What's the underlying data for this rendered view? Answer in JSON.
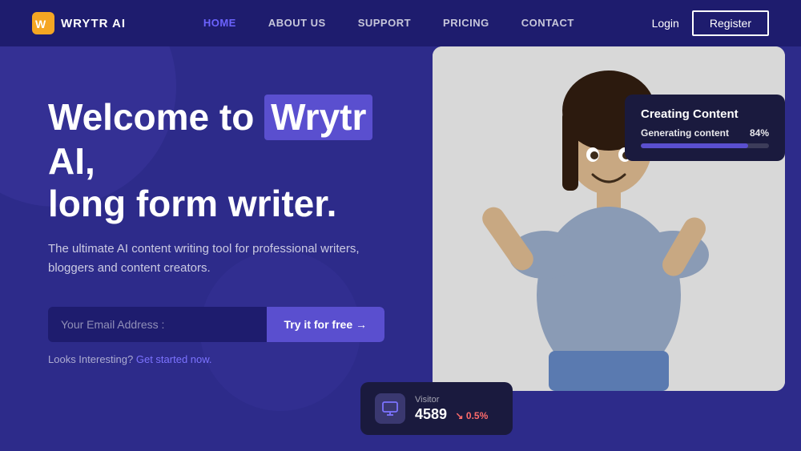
{
  "navbar": {
    "logo_text": "WRYTR AI",
    "links": [
      {
        "label": "HOME",
        "active": true
      },
      {
        "label": "ABOUT US",
        "active": false
      },
      {
        "label": "SUPPORT",
        "active": false
      },
      {
        "label": "PRICING",
        "active": false
      },
      {
        "label": "CONTACT",
        "active": false
      }
    ],
    "login_label": "Login",
    "register_label": "Register"
  },
  "hero": {
    "title_prefix": "Welcome to",
    "title_highlight": "Wrytr",
    "title_suffix": "AI,",
    "title_line2": "long form writer.",
    "subtitle": "The ultimate AI content writing tool for professional writers, bloggers and content creators.",
    "email_placeholder": "Your Email Address :",
    "cta_button": "Try it for free →",
    "note_prefix": "Looks Interesting?",
    "note_link": "Get started now."
  },
  "creating_content": {
    "title": "Creating Content",
    "label": "Generating content",
    "percent": "84%",
    "percent_value": 84
  },
  "visitor": {
    "label": "Visitor",
    "count": "4589",
    "trend": "↘ 0.5%"
  },
  "colors": {
    "accent": "#5a4fcf",
    "background": "#2d2b8a",
    "nav_bg": "#1e1c6e",
    "card_bg": "#1a1a3e",
    "trend_down": "#ff6b6b"
  }
}
